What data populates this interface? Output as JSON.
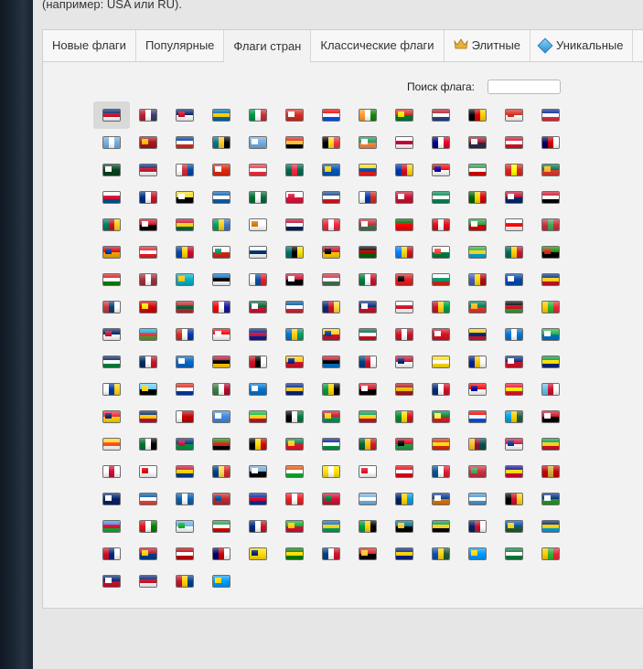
{
  "hint_text": "(например: USA или RU).",
  "tabs": [
    {
      "label": "Новые флаги",
      "icon": ""
    },
    {
      "label": "Популярные",
      "icon": ""
    },
    {
      "label": "Флаги стран",
      "icon": "",
      "active": true
    },
    {
      "label": "Классические флаги",
      "icon": ""
    },
    {
      "label": "Элитные",
      "icon": "crown-icon"
    },
    {
      "label": "Уникальные",
      "icon": "diamond-icon"
    }
  ],
  "search": {
    "label": "Поиск флага:",
    "value": "",
    "placeholder": ""
  },
  "selected_flag_index": 0,
  "flags": [
    [
      "GB",
      "#012169",
      "#c8102e",
      "#ffffff"
    ],
    [
      "US",
      "#b22234",
      "#ffffff",
      "#3c3b6e"
    ],
    [
      "GB2",
      "#012169",
      "#c8102e",
      "#ffffff"
    ],
    [
      "SE",
      "#006aa7",
      "#fecc00",
      "#006aa7"
    ],
    [
      "IT",
      "#009246",
      "#ffffff",
      "#ce2b37"
    ],
    [
      "CA",
      "#d52b1e",
      "#ffffff",
      "#d52b1e"
    ],
    [
      "PR",
      "#ed0000",
      "#ffffff",
      "#0050f0"
    ],
    [
      "IN",
      "#ff9933",
      "#ffffff",
      "#138808"
    ],
    [
      "BO",
      "#d52b1e",
      "#f9e300",
      "#007934"
    ],
    [
      "NL",
      "#ae1c28",
      "#ffffff",
      "#21468b"
    ],
    [
      "DE",
      "#000000",
      "#dd0000",
      "#ffce00"
    ],
    [
      "CH",
      "#d52b1e",
      "#d52b1e",
      "#ffffff"
    ],
    [
      "FR",
      "#002395",
      "#ffffff",
      "#ed2939"
    ],
    [
      "AR",
      "#74acdf",
      "#ffffff",
      "#74acdf"
    ],
    [
      "ES",
      "#aa151b",
      "#f1bf00",
      "#aa151b"
    ],
    [
      "CL",
      "#0039a6",
      "#ffffff",
      "#d52b1e"
    ],
    [
      "BS",
      "#00778b",
      "#ffc72c",
      "#000000"
    ],
    [
      "AR2",
      "#74acdf",
      "#ffffff",
      "#74acdf"
    ],
    [
      "TL",
      "#dc241f",
      "#ffc726",
      "#000000"
    ],
    [
      "BE",
      "#000000",
      "#fdda24",
      "#ef3340"
    ],
    [
      "IE",
      "#169b62",
      "#ffffff",
      "#ff883e"
    ],
    [
      "JP",
      "#ffffff",
      "#bc002d",
      "#ffffff"
    ],
    [
      "AU",
      "#00008b",
      "#ffffff",
      "#e4002b"
    ],
    [
      "TH",
      "#a51931",
      "#f4f5f8",
      "#2d2a4a"
    ],
    [
      "PE",
      "#d91023",
      "#ffffff",
      "#d91023"
    ],
    [
      "MY",
      "#010066",
      "#cc0001",
      "#ffffff"
    ],
    [
      "PK",
      "#01411c",
      "#ffffff",
      "#01411c"
    ],
    [
      "NZ",
      "#00247d",
      "#cc142b",
      "#ffffff"
    ],
    [
      "KR",
      "#ffffff",
      "#cd2e3a",
      "#0047a0"
    ],
    [
      "HK",
      "#de2910",
      "#ffffff",
      "#de2910"
    ],
    [
      "SG",
      "#ef3340",
      "#ffffff",
      "#ef3340"
    ],
    [
      "BD",
      "#006a4e",
      "#f42a41",
      "#006a4e"
    ],
    [
      "UA",
      "#0057b7",
      "#ffd700",
      "#0057b7"
    ],
    [
      "EC",
      "#ffdd00",
      "#034ea2",
      "#ed1c24"
    ],
    [
      "PH",
      "#0038a8",
      "#ce1126",
      "#fcd116"
    ],
    [
      "TW",
      "#fe0000",
      "#000095",
      "#ffffff"
    ],
    [
      "IR",
      "#239f40",
      "#ffffff",
      "#da0000"
    ],
    [
      "VN",
      "#da251d",
      "#ffff00",
      "#da251d"
    ],
    [
      "ZA",
      "#007749",
      "#ffb81c",
      "#de3831"
    ],
    [
      "PA",
      "#ffffff",
      "#d21034",
      "#005293"
    ],
    [
      "NC",
      "#002b7f",
      "#ffffff",
      "#ce1126"
    ],
    [
      "BN",
      "#f7e017",
      "#ffffff",
      "#000000"
    ],
    [
      "GR",
      "#0d5eaf",
      "#ffffff",
      "#0d5eaf"
    ],
    [
      "SA",
      "#006c35",
      "#ffffff",
      "#006c35"
    ],
    [
      "PL",
      "#ffffff",
      "#dc143c",
      "#dc143c"
    ],
    [
      "CZ",
      "#11457e",
      "#ffffff",
      "#d7141a"
    ],
    [
      "RU",
      "#ffffff",
      "#0039a6",
      "#d52b1e"
    ],
    [
      "DK",
      "#c8102e",
      "#ffffff",
      "#c8102e"
    ],
    [
      "NG",
      "#008751",
      "#ffffff",
      "#008751"
    ],
    [
      "ZW",
      "#006400",
      "#ffd200",
      "#d40000"
    ],
    [
      "LR",
      "#bf0a30",
      "#ffffff",
      "#002868"
    ],
    [
      "EG",
      "#ce1126",
      "#ffffff",
      "#000000"
    ],
    [
      "CM",
      "#007a5e",
      "#ce1126",
      "#fcd116"
    ],
    [
      "YE",
      "#ce1126",
      "#ffffff",
      "#000000"
    ],
    [
      "GH",
      "#ce1126",
      "#fcd116",
      "#006b3f"
    ],
    [
      "GA",
      "#009e60",
      "#fcd116",
      "#3a75c4"
    ],
    [
      "CY",
      "#ffffff",
      "#d57800",
      "#ffffff"
    ],
    [
      "NO",
      "#ba0c2f",
      "#ffffff",
      "#00205b"
    ],
    [
      "AT",
      "#ed2939",
      "#ffffff",
      "#ed2939"
    ],
    [
      "HU",
      "#ce2939",
      "#ffffff",
      "#477050"
    ],
    [
      "PT",
      "#006600",
      "#ff0000",
      "#ff0000"
    ],
    [
      "TR",
      "#e30a17",
      "#ffffff",
      "#e30a17"
    ],
    [
      "IR2",
      "#239f40",
      "#ffffff",
      "#da0000"
    ],
    [
      "GE",
      "#ffffff",
      "#ff0000",
      "#ffffff"
    ],
    [
      "BY",
      "#c8313e",
      "#4aa657",
      "#c8313e"
    ],
    [
      "AM",
      "#d90012",
      "#0033a0",
      "#f2a800"
    ],
    [
      "LB",
      "#ed1c24",
      "#ffffff",
      "#ed1c24"
    ],
    [
      "MD",
      "#0046ae",
      "#ffd200",
      "#cc092f"
    ],
    [
      "BG",
      "#ffffff",
      "#00966e",
      "#d62612"
    ],
    [
      "FI",
      "#ffffff",
      "#002f6c",
      "#ffffff"
    ],
    [
      "MZ",
      "#007168",
      "#000000",
      "#fce100"
    ],
    [
      "AO",
      "#cc092f",
      "#000000",
      "#ffcb00"
    ],
    [
      "KE",
      "#000000",
      "#bb0000",
      "#006600"
    ],
    [
      "CD",
      "#007fff",
      "#f7d618",
      "#ce1021"
    ],
    [
      "MG",
      "#ffffff",
      "#fc3d32",
      "#007e3a"
    ],
    [
      "TZ",
      "#1eb53a",
      "#fcd116",
      "#00a3dd"
    ],
    [
      "TG",
      "#006a4e",
      "#ffce00",
      "#d21034"
    ],
    [
      "ZM",
      "#198a00",
      "#de2010",
      "#000000"
    ],
    [
      "OM",
      "#db161b",
      "#ffffff",
      "#008000"
    ],
    [
      "LV",
      "#9e3039",
      "#ffffff",
      "#9e3039"
    ],
    [
      "KZ",
      "#00afca",
      "#fec50c",
      "#00afca"
    ],
    [
      "EE",
      "#0072ce",
      "#000000",
      "#ffffff"
    ],
    [
      "SK",
      "#ffffff",
      "#0b4ea2",
      "#ee1c25"
    ],
    [
      "SD",
      "#d21034",
      "#ffffff",
      "#000000"
    ],
    [
      "HU2",
      "#ce2939",
      "#ffffff",
      "#477050"
    ],
    [
      "KW",
      "#007a3d",
      "#ffffff",
      "#ce1126"
    ],
    [
      "AL",
      "#e41e20",
      "#000000",
      "#e41e20"
    ],
    [
      "BG2",
      "#ffffff",
      "#00966e",
      "#d62612"
    ],
    [
      "SZ",
      "#3e5eb9",
      "#ffd900",
      "#b10c0c"
    ],
    [
      "SV",
      "#0047ab",
      "#ffffff",
      "#0047ab"
    ],
    [
      "RO",
      "#002b7f",
      "#fcd116",
      "#ce1126"
    ],
    [
      "RS",
      "#c6363c",
      "#0c4076",
      "#ffffff"
    ],
    [
      "MK",
      "#d20000",
      "#ffe600",
      "#d20000"
    ],
    [
      "MA",
      "#c1272d",
      "#006233",
      "#c1272d"
    ],
    [
      "HR",
      "#ff0000",
      "#ffffff",
      "#171796"
    ],
    [
      "DZ",
      "#006233",
      "#ffffff",
      "#d21034"
    ],
    [
      "IS",
      "#02529c",
      "#ffffff",
      "#dc1e35"
    ],
    [
      "LI",
      "#002b7f",
      "#ce1126",
      "#ffd83d"
    ],
    [
      "CR",
      "#002b7f",
      "#ffffff",
      "#ce1126"
    ],
    [
      "MT",
      "#ffffff",
      "#cf142b",
      "#ffffff"
    ],
    [
      "GW",
      "#ce1126",
      "#fcd116",
      "#009e49"
    ],
    [
      "ZA2",
      "#007749",
      "#ffb81c",
      "#de3831"
    ],
    [
      "MW",
      "#000000",
      "#ce1126",
      "#339e35"
    ],
    [
      "MM",
      "#fecb00",
      "#34b233",
      "#ea2839"
    ],
    [
      "GB3",
      "#012169",
      "#c8102e",
      "#ffffff"
    ],
    [
      "AZ",
      "#00b5e2",
      "#ef3340",
      "#509e2f"
    ],
    [
      "PY",
      "#d52b1e",
      "#ffffff",
      "#0038a8"
    ],
    [
      "ID",
      "#ff0000",
      "#ffffff",
      "#ffffff"
    ],
    [
      "HT",
      "#00209f",
      "#d21034",
      "#00209f"
    ],
    [
      "VC",
      "#0072c6",
      "#fcd116",
      "#009e60"
    ],
    [
      "CO",
      "#fcd116",
      "#003893",
      "#ce1126"
    ],
    [
      "MX",
      "#006847",
      "#ffffff",
      "#ce1126"
    ],
    [
      "BH",
      "#ce1126",
      "#ffffff",
      "#ce1126"
    ],
    [
      "PE2",
      "#d91023",
      "#ffffff",
      "#d91023"
    ],
    [
      "VE",
      "#ffcc00",
      "#00247d",
      "#cf142b"
    ],
    [
      "HN",
      "#0073cf",
      "#ffffff",
      "#0073cf"
    ],
    [
      "SL",
      "#1eb53a",
      "#ffffff",
      "#0072c6"
    ],
    [
      "VG",
      "#012169",
      "#ffffff",
      "#00843d"
    ],
    [
      "DO",
      "#002d62",
      "#ffffff",
      "#ce1126"
    ],
    [
      "NI",
      "#0067c6",
      "#ffffff",
      "#0067c6"
    ],
    [
      "AO2",
      "#cc092f",
      "#000000",
      "#ffcb00"
    ],
    [
      "TT",
      "#ce1126",
      "#000000",
      "#ffffff"
    ],
    [
      "VE2",
      "#ffcc00",
      "#00247d",
      "#cf142b"
    ],
    [
      "AG",
      "#ce1126",
      "#000000",
      "#0072c6"
    ],
    [
      "BZ",
      "#003f87",
      "#ce1126",
      "#ffffff"
    ],
    [
      "BM",
      "#c8102e",
      "#012169",
      "#ffffff"
    ],
    [
      "VA",
      "#ffe000",
      "#ffffff",
      "#ffe000"
    ],
    [
      "BA",
      "#002395",
      "#fecb00",
      "#ffffff"
    ],
    [
      "CU",
      "#002a8f",
      "#ffffff",
      "#cf142b"
    ],
    [
      "BR",
      "#009c3b",
      "#ffdf00",
      "#002776"
    ],
    [
      "UY",
      "#ffffff",
      "#0038a8",
      "#fcd116"
    ],
    [
      "LC",
      "#66ccff",
      "#fcd116",
      "#000000"
    ],
    [
      "PY2",
      "#d52b1e",
      "#ffffff",
      "#0038a8"
    ],
    [
      "SR",
      "#377e3f",
      "#ffffff",
      "#b40a2d"
    ],
    [
      "HN2",
      "#0073cf",
      "#ffffff",
      "#0073cf"
    ],
    [
      "BB",
      "#00267f",
      "#ffc726",
      "#00267f"
    ],
    [
      "JM",
      "#009b3a",
      "#fed100",
      "#000000"
    ],
    [
      "EG2",
      "#ce1126",
      "#ffffff",
      "#000000"
    ],
    [
      "ES2",
      "#aa151b",
      "#f1bf00",
      "#aa151b"
    ],
    [
      "CR2",
      "#002b7f",
      "#ffffff",
      "#ce1126"
    ],
    [
      "TW2",
      "#fe0000",
      "#000095",
      "#ffffff"
    ],
    [
      "KG",
      "#e8112d",
      "#ffef00",
      "#e8112d"
    ],
    [
      "FJ",
      "#68bfe5",
      "#c8102e",
      "#ffffff"
    ],
    [
      "MU",
      "#ea2839",
      "#1a206d",
      "#ffd500"
    ],
    [
      "TD",
      "#002664",
      "#fecb00",
      "#c60c30"
    ],
    [
      "TO",
      "#ffffff",
      "#c10000",
      "#c10000"
    ],
    [
      "SO",
      "#4189dd",
      "#ffffff",
      "#4189dd"
    ],
    [
      "ML",
      "#14b53a",
      "#fcd116",
      "#ce1126"
    ],
    [
      "EH",
      "#000000",
      "#ffffff",
      "#007a3d"
    ],
    [
      "GN",
      "#ce1126",
      "#fcd116",
      "#009460"
    ],
    [
      "GY",
      "#009e49",
      "#fcd116",
      "#ce1126"
    ],
    [
      "ET",
      "#078930",
      "#fcdd09",
      "#da121a"
    ],
    [
      "SN",
      "#00853f",
      "#fdef42",
      "#e31b23"
    ],
    [
      "PR2",
      "#ed0000",
      "#ffffff",
      "#0050f0"
    ],
    [
      "RW",
      "#00a1de",
      "#fad201",
      "#20603d"
    ],
    [
      "YE2",
      "#ce1126",
      "#ffffff",
      "#000000"
    ],
    [
      "BT",
      "#ffd520",
      "#ff4e12",
      "#ffffff"
    ],
    [
      "AE",
      "#00732f",
      "#ffffff",
      "#000000"
    ],
    [
      "NA",
      "#003580",
      "#d21034",
      "#009543"
    ],
    [
      "ZM2",
      "#198a00",
      "#de2010",
      "#000000"
    ],
    [
      "UG",
      "#000000",
      "#fcdc04",
      "#d90000"
    ],
    [
      "BJ",
      "#008751",
      "#fcd116",
      "#e8112d"
    ],
    [
      "LS",
      "#00209f",
      "#ffffff",
      "#009543"
    ],
    [
      "MR",
      "#006233",
      "#ffc400",
      "#d01c1f"
    ],
    [
      "LY",
      "#e70013",
      "#000000",
      "#239e46"
    ],
    [
      "CN",
      "#de2910",
      "#ffde00",
      "#de2910"
    ],
    [
      "LK",
      "#ffbe29",
      "#8d153a",
      "#00534e"
    ],
    [
      "NP",
      "#dc143c",
      "#003893",
      "#ffffff"
    ],
    [
      "GY2",
      "#009e49",
      "#fcd116",
      "#ce1126"
    ],
    [
      "GL",
      "#ffffff",
      "#d00c33",
      "#ffffff"
    ],
    [
      "GI",
      "#ffffff",
      "#da000c",
      "#ffffff"
    ],
    [
      "KI",
      "#c8102e",
      "#ffd100",
      "#003f87"
    ],
    [
      "SC",
      "#003f87",
      "#fcd856",
      "#d62828"
    ],
    [
      "BW",
      "#75aadb",
      "#ffffff",
      "#000000"
    ],
    [
      "NE",
      "#e05206",
      "#ffffff",
      "#0db02b"
    ],
    [
      "VA2",
      "#ffe000",
      "#ffffff",
      "#ffe000"
    ],
    [
      "JE",
      "#ffffff",
      "#df112d",
      "#ffffff"
    ],
    [
      "TN",
      "#e70013",
      "#ffffff",
      "#e70013"
    ],
    [
      "IS2",
      "#02529c",
      "#ffffff",
      "#dc1e35"
    ],
    [
      "BY2",
      "#c8313e",
      "#4aa657",
      "#c8313e"
    ],
    [
      "AD",
      "#10069f",
      "#fedd00",
      "#d50032"
    ],
    [
      "ME",
      "#c40308",
      "#d4af3a",
      "#c40308"
    ],
    [
      "CK",
      "#012169",
      "#ffffff",
      "#012169"
    ],
    [
      "PM",
      "#0055a4",
      "#ffffff",
      "#ef4135"
    ],
    [
      "GR2",
      "#0d5eaf",
      "#ffffff",
      "#0d5eaf"
    ],
    [
      "MN",
      "#c4272f",
      "#015197",
      "#c4272f"
    ],
    [
      "KH",
      "#032ea1",
      "#e00025",
      "#032ea1"
    ],
    [
      "LB2",
      "#ed1c24",
      "#ffffff",
      "#ed1c24"
    ],
    [
      "MV",
      "#d21034",
      "#007e3a",
      "#d21034"
    ],
    [
      "FM",
      "#75b2dd",
      "#ffffff",
      "#75b2dd"
    ],
    [
      "TV",
      "#012169",
      "#ffd100",
      "#00a0e2"
    ],
    [
      "MH",
      "#003893",
      "#ffffff",
      "#dd7500"
    ],
    [
      "GT",
      "#4997d0",
      "#ffffff",
      "#4997d0"
    ],
    [
      "PG",
      "#000000",
      "#ce1126",
      "#fcd116"
    ],
    [
      "CF",
      "#003082",
      "#ffffff",
      "#289728"
    ],
    [
      "ER",
      "#4189dd",
      "#ea0437",
      "#12ad2b"
    ],
    [
      "OM2",
      "#db161b",
      "#ffffff",
      "#008000"
    ],
    [
      "DJ",
      "#6ab2e7",
      "#12ad2b",
      "#ffffff"
    ],
    [
      "IR3",
      "#239f40",
      "#ffffff",
      "#da0000"
    ],
    [
      "CR3",
      "#002b7f",
      "#ffffff",
      "#ce1126"
    ],
    [
      "ST",
      "#12ad2b",
      "#ffce00",
      "#d21034"
    ],
    [
      "VC2",
      "#0072c6",
      "#fcd116",
      "#009e60"
    ],
    [
      "JM2",
      "#009b3a",
      "#fed100",
      "#000000"
    ],
    [
      "BS2",
      "#00778b",
      "#ffc72c",
      "#000000"
    ],
    [
      "KN",
      "#009e49",
      "#fcd116",
      "#000000"
    ],
    [
      "GB4",
      "#012169",
      "#c8102e",
      "#ffffff"
    ],
    [
      "SB",
      "#0051ba",
      "#fcd116",
      "#215b33"
    ],
    [
      "TV2",
      "#012169",
      "#ffd100",
      "#00a0e2"
    ],
    [
      "WS",
      "#ce1126",
      "#002b7f",
      "#ffffff"
    ],
    [
      "KI2",
      "#c8102e",
      "#ffd100",
      "#003f87"
    ],
    [
      "TO2",
      "#c10000",
      "#ffffff",
      "#c10000"
    ],
    [
      "MY2",
      "#010066",
      "#cc0001",
      "#ffffff"
    ],
    [
      "NU",
      "#fedd00",
      "#012169",
      "#fedd00"
    ],
    [
      "CC",
      "#008000",
      "#ffe000",
      "#008000"
    ],
    [
      "AQ",
      "#003f87",
      "#ffffff",
      "#cf142b"
    ],
    [
      "TL2",
      "#dc241f",
      "#ffc726",
      "#000000"
    ],
    [
      "TK",
      "#00247d",
      "#fed100",
      "#00247d"
    ],
    [
      "SB2",
      "#0051ba",
      "#fcd116",
      "#215b33"
    ],
    [
      "PW",
      "#0099ff",
      "#ffde00",
      "#0099ff"
    ],
    [
      "NF",
      "#047c3c",
      "#ffffff",
      "#047c3c"
    ],
    [
      "MM2",
      "#fecb00",
      "#34b233",
      "#ea2839"
    ],
    [
      "FK",
      "#012169",
      "#ffffff",
      "#c8102e"
    ],
    [
      "GB5",
      "#012169",
      "#c8102e",
      "#ffffff"
    ],
    [
      "KI3",
      "#c8102e",
      "#ffd100",
      "#003f87"
    ],
    [
      "PW2",
      "#0099ff",
      "#ffde00",
      "#0099ff"
    ]
  ]
}
